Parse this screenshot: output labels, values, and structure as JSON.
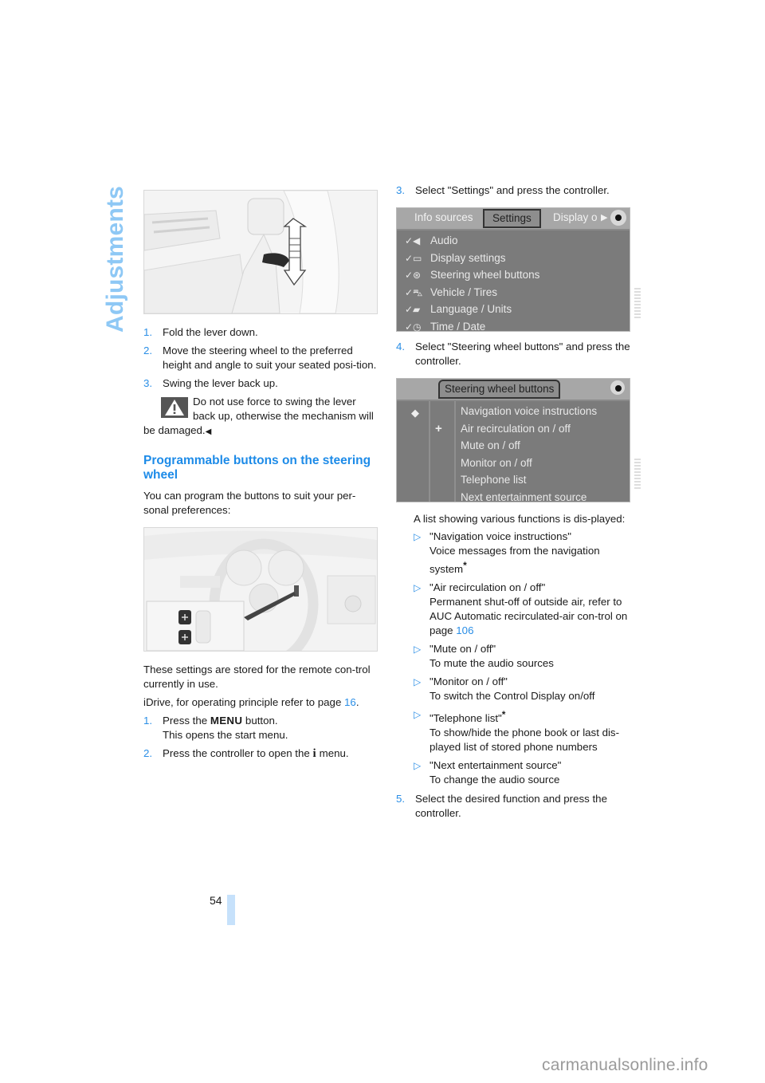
{
  "page": {
    "section_title": "Adjustments",
    "page_number": "54",
    "watermark": "carmanualsonline.info",
    "accent_color": "#2a8ee6"
  },
  "left": {
    "figure1": {
      "alt": "steering-column-lever-illustration"
    },
    "steps_a": [
      {
        "num": "1.",
        "text": "Fold the lever down."
      },
      {
        "num": "2.",
        "text": "Move the steering wheel to the preferred height and angle to suit your seated posi-tion."
      },
      {
        "num": "3.",
        "text": "Swing the lever back up."
      }
    ],
    "warning": {
      "text": "Do not use force to swing the lever back up, otherwise the mechanism will be damaged.",
      "end_mark": "◀"
    },
    "heading": "Programmable buttons on the steering wheel",
    "intro": "You can program the buttons to suit your per-sonal preferences:",
    "figure2": {
      "alt": "steering-wheel-buttons-illustration"
    },
    "stored_text": "These settings are stored for the remote con-trol currently in use.",
    "idrive_text": "iDrive, for operating principle refer to page ",
    "idrive_link": "16",
    "idrive_end": ".",
    "steps_b": [
      {
        "num": "1.",
        "pre": "Press the ",
        "key": "MENU",
        "post": " button.",
        "line2": "This opens the start menu."
      },
      {
        "num": "2.",
        "pre": "Press the controller to open the ",
        "key": "i",
        "post": " menu."
      }
    ]
  },
  "right": {
    "step3": {
      "num": "3.",
      "text": "Select \"Settings\" and press the controller."
    },
    "screen1": {
      "tabs": [
        "Info sources",
        "Settings",
        "Display o"
      ],
      "active_tab": "Settings",
      "rows": [
        {
          "icon": "audio-icon",
          "glyph": "✓◀",
          "label": "Audio"
        },
        {
          "icon": "display-settings-icon",
          "glyph": "✓▭",
          "label": "Display settings"
        },
        {
          "icon": "steering-wheel-icon",
          "glyph": "✓⊛",
          "label": "Steering wheel buttons"
        },
        {
          "icon": "vehicle-icon",
          "glyph": "✓⛍",
          "label": "Vehicle / Tires"
        },
        {
          "icon": "language-icon",
          "glyph": "✓▰",
          "label": "Language / Units"
        },
        {
          "icon": "clock-icon",
          "glyph": "✓◷",
          "label": "Time / Date"
        }
      ]
    },
    "step4": {
      "num": "4.",
      "text": "Select \"Steering wheel buttons\" and press the controller."
    },
    "screen2": {
      "title": "Steering wheel buttons",
      "rows": [
        "Navigation voice instructions",
        "Air recirculation on / off",
        "Mute on / off",
        "Monitor on / off",
        "Telephone list",
        "Next entertainment source"
      ]
    },
    "list_intro": "A list showing various functions is dis-played:",
    "bullets": [
      {
        "title": "\"Navigation voice instructions\"",
        "desc": "Voice messages from the navigation system",
        "star_on": "desc"
      },
      {
        "title": "\"Air recirculation on / off\"",
        "desc": "Permanent shut-off of outside air, refer to AUC Automatic recirculated-air con-trol on page ",
        "link": "106"
      },
      {
        "title": "\"Mute on / off\"",
        "desc": "To mute the audio sources"
      },
      {
        "title": "\"Monitor on / off\"",
        "desc": "To switch the Control Display on/off"
      },
      {
        "title": "\"Telephone list\"",
        "desc": "To show/hide the phone book or last dis-played list of stored phone numbers",
        "star_on": "title"
      },
      {
        "title": "\"Next entertainment source\"",
        "desc": "To change the audio source"
      }
    ],
    "bullet_marker": "▷",
    "star": "*",
    "step5": {
      "num": "5.",
      "text": "Select the desired function and press the controller."
    }
  }
}
